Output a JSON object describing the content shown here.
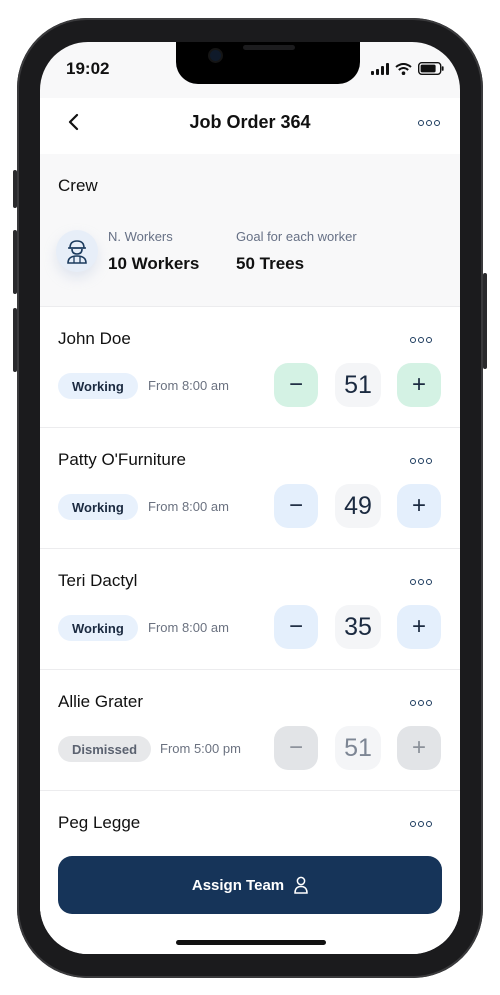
{
  "status": {
    "time": "19:02"
  },
  "header": {
    "title": "Job Order 364"
  },
  "crew": {
    "title": "Crew",
    "workers_label": "N. Workers",
    "workers_value": "10 Workers",
    "goal_label": "Goal for each worker",
    "goal_value": "50 Trees"
  },
  "workers": [
    {
      "name": "John Doe",
      "status": "Working",
      "from": "From 8:00 am",
      "count": "51"
    },
    {
      "name": "Patty O'Furniture",
      "status": "Working",
      "from": "From 8:00 am",
      "count": "49"
    },
    {
      "name": "Teri Dactyl",
      "status": "Working",
      "from": "From 8:00 am",
      "count": "35"
    },
    {
      "name": "Allie Grater",
      "status": "Dismissed",
      "from": "From 5:00 pm",
      "count": "51"
    },
    {
      "name": "Peg Legge"
    }
  ],
  "footer": {
    "assign_label": "Assign Team"
  },
  "icons": {
    "back": "chevron-left-icon",
    "more": "more-dots-icon",
    "worker": "worker-icon",
    "person": "person-icon"
  },
  "colors": {
    "primary": "#163459",
    "working_badge": "#e8f1fc",
    "dismissed_badge": "#e7e8ea",
    "goal_reached": "#d4f2e4",
    "stepper": "#e4effc"
  }
}
